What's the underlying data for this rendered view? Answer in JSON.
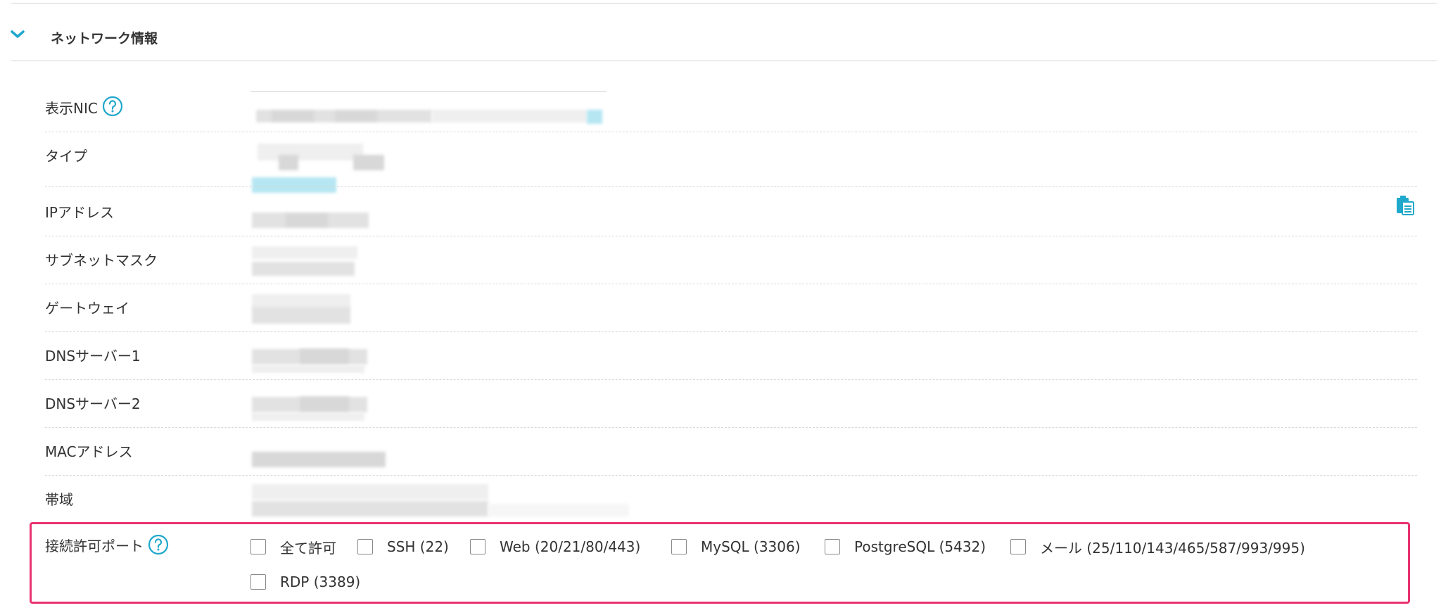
{
  "section": {
    "title": "ネットワーク情報"
  },
  "rows": [
    {
      "label": "表示NIC"
    },
    {
      "label": "タイプ"
    },
    {
      "label": "IPアドレス"
    },
    {
      "label": "サブネットマスク"
    },
    {
      "label": "ゲートウェイ"
    },
    {
      "label": "DNSサーバー1"
    },
    {
      "label": "DNSサーバー2"
    },
    {
      "label": "MACアドレス"
    },
    {
      "label": "帯域"
    }
  ],
  "ports": {
    "label": "接続許可ポート",
    "options": [
      {
        "label": "全て許可",
        "checked": false
      },
      {
        "label": "SSH (22)",
        "checked": false
      },
      {
        "label": "Web (20/21/80/443)",
        "checked": false
      },
      {
        "label": "MySQL (3306)",
        "checked": false
      },
      {
        "label": "PostgreSQL (5432)",
        "checked": false
      },
      {
        "label": "メール (25/110/143/465/587/993/995)",
        "checked": false
      },
      {
        "label": "RDP (3389)",
        "checked": false
      }
    ]
  },
  "icons": {
    "chevron": "chevron-down-icon",
    "help": "help-circle-icon",
    "copy": "clipboard-copy-icon"
  },
  "colors": {
    "accent": "#1fa8cc",
    "highlight_border": "#e8336f",
    "text": "#333333",
    "divider": "#d6d6d6"
  }
}
